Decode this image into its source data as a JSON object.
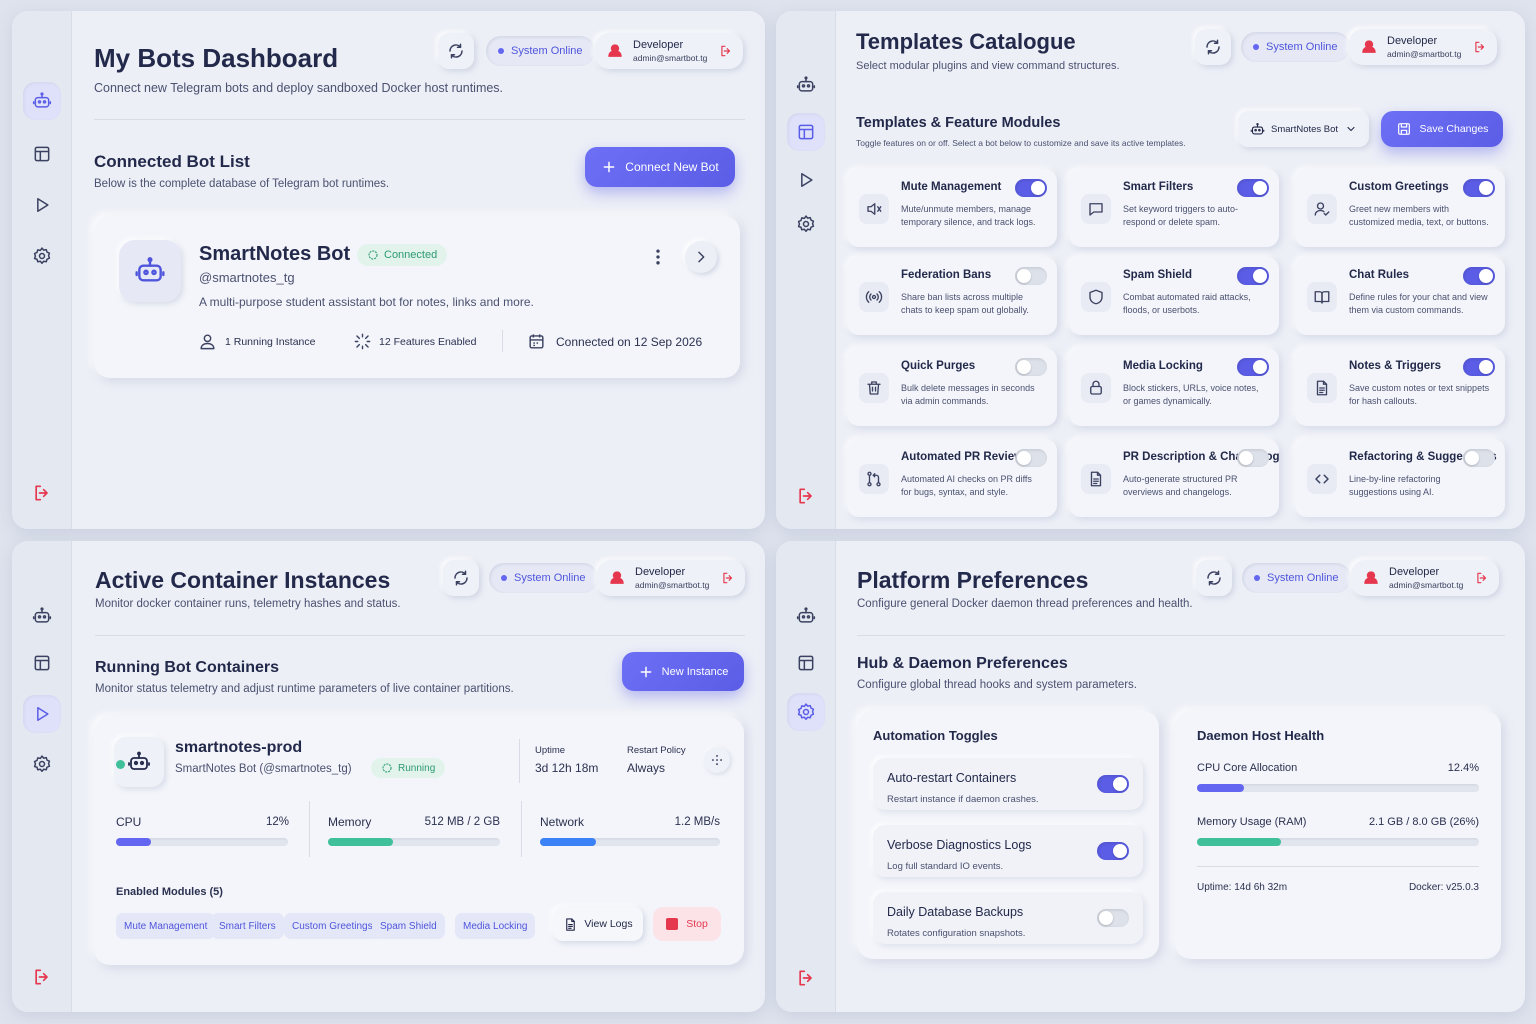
{
  "common": {
    "status": "System Online",
    "user_name": "Developer",
    "user_email": "admin@smartbot.tg"
  },
  "dashboard": {
    "title": "My Bots Dashboard",
    "subtitle": "Connect new Telegram bots and deploy sandboxed Docker host runtimes.",
    "section_title": "Connected Bot List",
    "section_subtitle": "Below is the complete database of Telegram bot runtimes.",
    "connect_button": "Connect New Bot",
    "bot": {
      "name": "SmartNotes Bot",
      "status": "Connected",
      "handle": "@smartnotes_tg",
      "description": "A multi-purpose student assistant bot for notes, links and more.",
      "instances": "1 Running Instance",
      "features": "12 Features Enabled",
      "connected": "Connected on 12 Sep 2026"
    }
  },
  "templates": {
    "title": "Templates Catalogue",
    "subtitle": "Select modular plugins and view command structures.",
    "section_title": "Templates & Feature Modules",
    "section_subtitle": "Toggle features on or off. Select a bot below to customize and save its active templates.",
    "bot_select": "SmartNotes Bot",
    "save_button": "Save Changes",
    "modules": [
      {
        "name": "Mute Management",
        "desc": "Mute/unmute members, manage temporary silence, and track logs.",
        "on": true,
        "icon": "speaker-icon"
      },
      {
        "name": "Smart Filters",
        "desc": "Set keyword triggers to auto-respond or delete spam.",
        "on": true,
        "icon": "chat-icon"
      },
      {
        "name": "Custom Greetings",
        "desc": "Greet new members with customized media, text, or buttons.",
        "on": true,
        "icon": "user-check-icon"
      },
      {
        "name": "Federation Bans",
        "desc": "Share ban lists across multiple chats to keep spam out globally.",
        "on": false,
        "icon": "broadcast-icon"
      },
      {
        "name": "Spam Shield",
        "desc": "Combat automated raid attacks, floods, or userbots.",
        "on": true,
        "icon": "shield-icon"
      },
      {
        "name": "Chat Rules",
        "desc": "Define rules for your chat and view them via custom commands.",
        "on": true,
        "icon": "book-icon"
      },
      {
        "name": "Quick Purges",
        "desc": "Bulk delete messages in seconds via admin commands.",
        "on": false,
        "icon": "trash-icon"
      },
      {
        "name": "Media Locking",
        "desc": "Block stickers, URLs, voice notes, or games dynamically.",
        "on": true,
        "icon": "lock-icon"
      },
      {
        "name": "Notes & Triggers",
        "desc": "Save custom notes or text snippets for hash callouts.",
        "on": true,
        "icon": "note-icon"
      },
      {
        "name": "Automated PR Review",
        "desc": "Automated AI checks on PR diffs for bugs, syntax, and style.",
        "on": false,
        "icon": "git-pull-icon"
      },
      {
        "name": "PR Description & Changelog",
        "desc": "Auto-generate structured PR overviews and changelogs.",
        "on": false,
        "icon": "document-icon"
      },
      {
        "name": "Refactoring & Suggestions",
        "desc": "Line-by-line refactoring suggestions using AI.",
        "on": false,
        "icon": "code-icon"
      }
    ]
  },
  "containers": {
    "title": "Active Container Instances",
    "subtitle": "Monitor docker container runs, telemetry hashes and status.",
    "section_title": "Running Bot Containers",
    "section_subtitle": "Monitor status telemetry and adjust runtime parameters of live container partitions.",
    "new_button": "New Instance",
    "instance": {
      "name": "smartnotes-prod",
      "bot": "SmartNotes Bot (@smartnotes_tg)",
      "status": "Running",
      "uptime_label": "Uptime",
      "uptime": "3d 12h 18m",
      "policy_label": "Restart Policy",
      "policy": "Always",
      "cpu_label": "CPU",
      "cpu_value": "12%",
      "cpu_fraction": 0.12,
      "mem_label": "Memory",
      "mem_value": "512 MB / 2 GB",
      "mem_fraction": 0.25,
      "net_label": "Network",
      "net_value": "1.2 MB/s",
      "net_fraction": 0.31,
      "modules_title": "Enabled Modules (5)",
      "modules": [
        "Mute Management",
        "Smart Filters",
        "Custom Greetings",
        "Spam Shield",
        "Media Locking"
      ],
      "logs_button": "View Logs",
      "stop_button": "Stop"
    }
  },
  "preferences": {
    "title": "Platform Preferences",
    "subtitle": "Configure general Docker daemon thread preferences and health.",
    "section_title": "Hub & Daemon Preferences",
    "section_subtitle": "Configure global thread hooks and system parameters.",
    "toggles_title": "Automation Toggles",
    "toggles": [
      {
        "name": "Auto-restart Containers",
        "desc": "Restart instance if daemon crashes.",
        "on": true
      },
      {
        "name": "Verbose Diagnostics Logs",
        "desc": "Log full standard IO events.",
        "on": true
      },
      {
        "name": "Daily Database Backups",
        "desc": "Rotates configuration snapshots.",
        "on": false
      }
    ],
    "health_title": "Daemon Host Health",
    "cpu_label": "CPU Core Allocation",
    "cpu_value": "12.4%",
    "cpu_fraction": 0.124,
    "mem_label": "Memory Usage (RAM)",
    "mem_value": "2.1 GB / 8.0 GB (26%)",
    "mem_fraction": 0.26,
    "uptime": "Uptime: 14d 6h 32m",
    "docker": "Docker: v25.0.3"
  },
  "colors": {
    "accent": "#5b5de6",
    "success": "#2c9a71",
    "danger": "#e5384f",
    "memory_bar": "#3fbf9a",
    "network_bar": "#3b82f6"
  }
}
